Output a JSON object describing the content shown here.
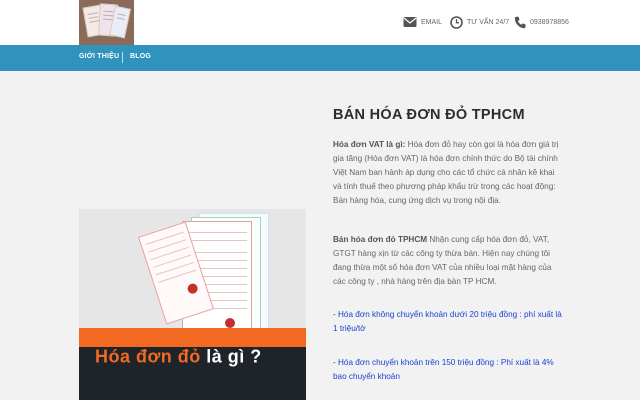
{
  "header": {
    "logo_icon": "invoice-stack-logo",
    "contacts": [
      {
        "icon": "envelope-icon",
        "label": "EMAIL"
      },
      {
        "icon": "clock-icon",
        "label": "TƯ VẤN 24/7"
      },
      {
        "icon": "phone-icon",
        "label": "0938978856"
      }
    ]
  },
  "nav": {
    "items": [
      "GIỚI THIỆU",
      "BLOG"
    ]
  },
  "hero": {
    "caption_main": "Hóa đơn đỏ",
    "caption_rest": " là gì ?"
  },
  "article": {
    "title": "BÁN HÓA ĐƠN ĐỎ TPHCM",
    "intro_bold": "Hóa đơn VAT là gì:",
    "intro_text": " Hóa đơn đỏ hay còn gọi là hóa đơn giá trị gia tăng (Hóa đơn VAT) là hóa đơn chính thức do Bộ tài chính Việt Nam ban hành áp dụng cho các tổ chức cá nhân kê khai và tính thuế theo phương pháp khấu trừ trong các hoạt động: Bán hàng hóa, cung ứng dịch vụ trong nội địa.",
    "sell_bold": "Bán hóa đơn đỏ TPHCM",
    "sell_text": " Nhận cung cấp hóa đơn đỏ, VAT, GTGT hàng xịn từ các công ty thừa bán. Hiện nay chúng tôi đang thừa một số hóa đơn VAT của nhiều loại mặt hàng của các công ty , nhà hàng trên địa bàn TP HCM.",
    "bullet_1": "- Hóa đơn không chuyển khoản dưới 20 triệu đồng : phí xuất là 1 triệu/tờ",
    "bullet_2": "- Hóa đơn chuyển khoản trên 150 triệu đồng : Phí xuất là 4% bao chuyển khoản"
  },
  "colors": {
    "nav_bg": "#2f93bd",
    "accent_orange": "#f26a21",
    "link_blue": "#1a3fd0"
  }
}
